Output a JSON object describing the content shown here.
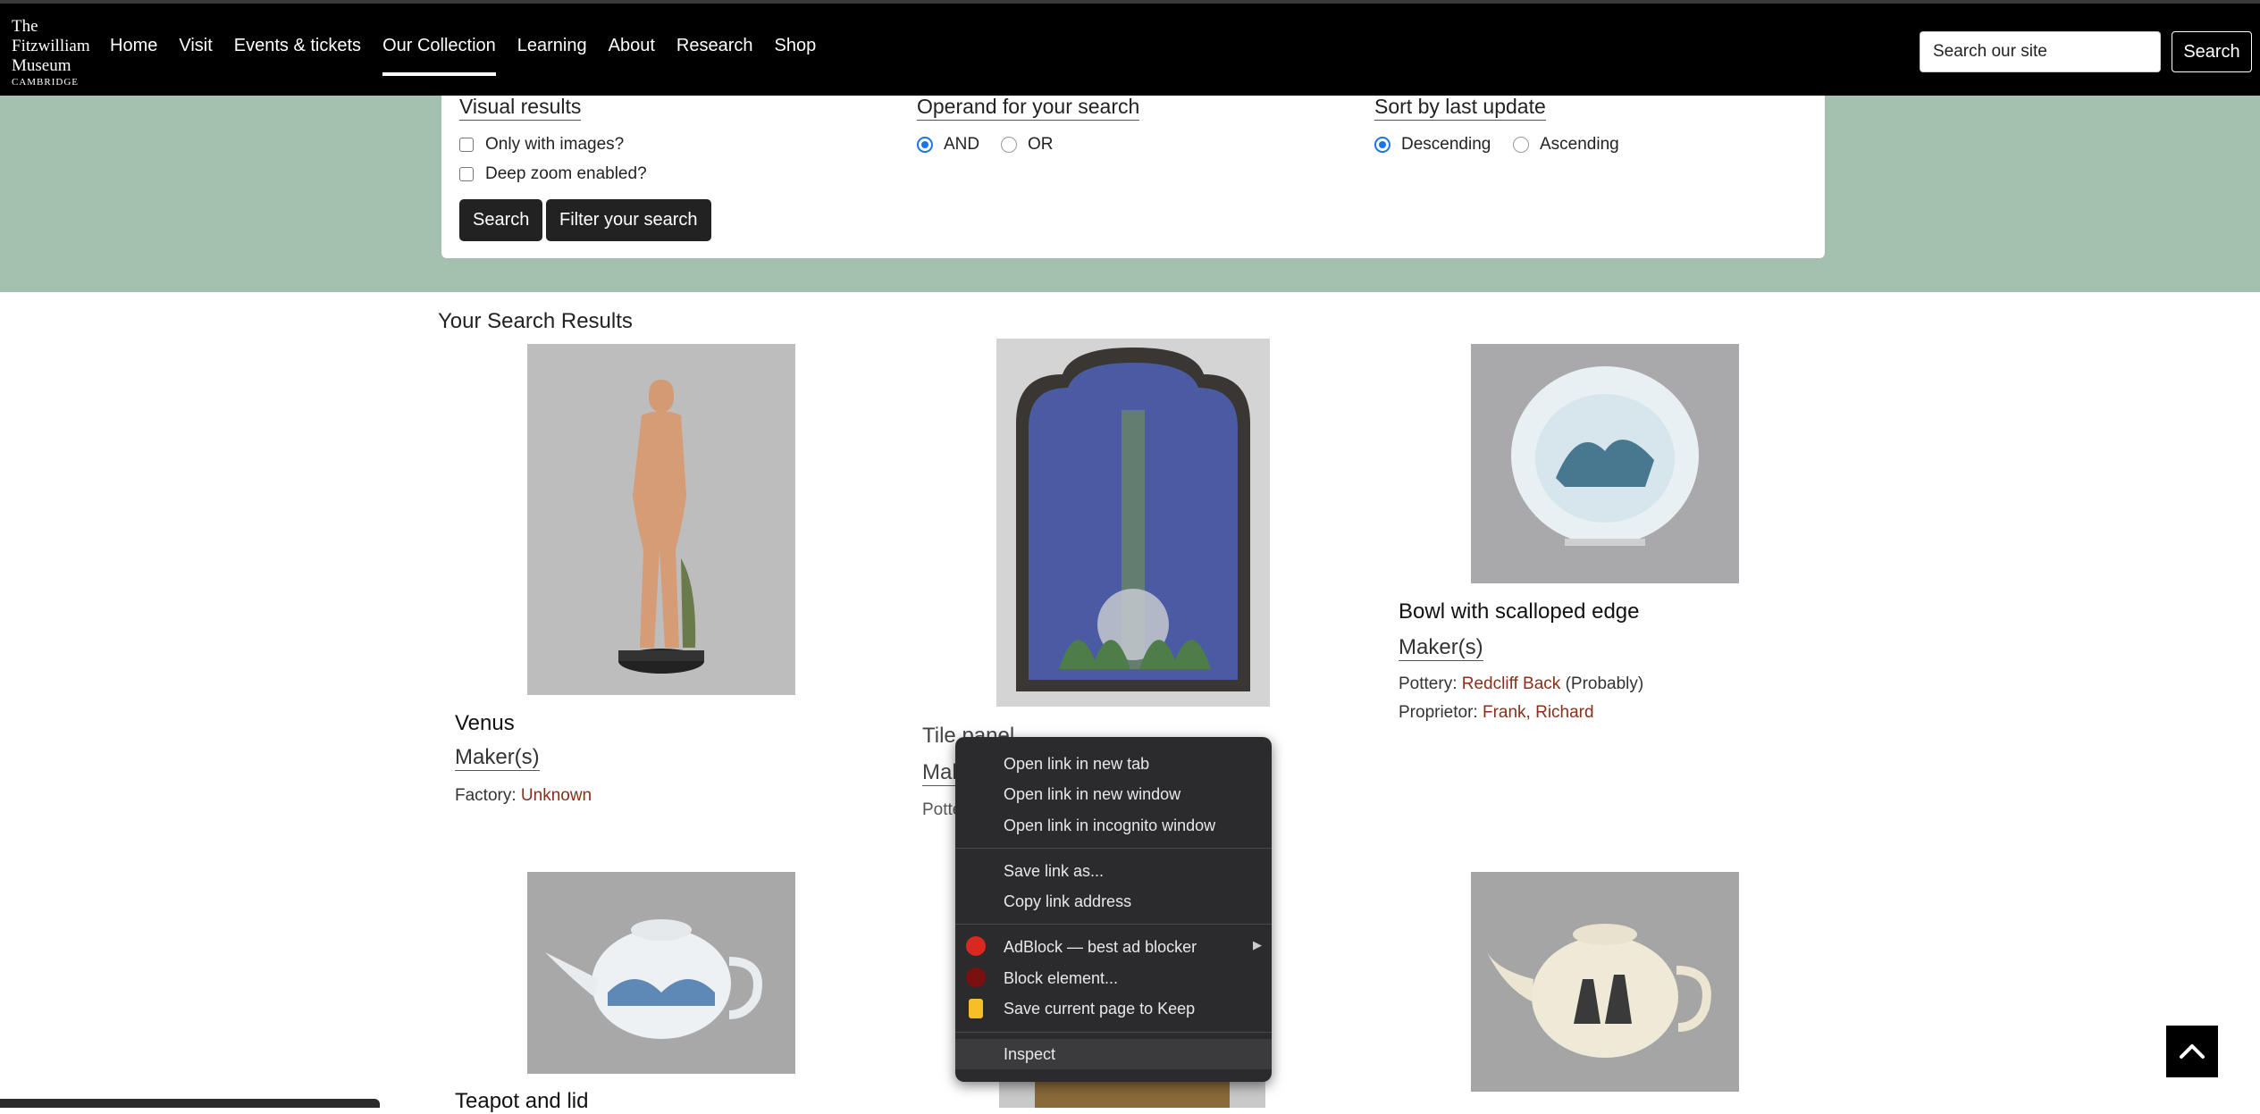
{
  "header": {
    "logo": {
      "line1": "The",
      "line2": "Fitzwilliam",
      "line3": "Museum",
      "line4": "CAMBRIDGE"
    },
    "nav": [
      "Home",
      "Visit",
      "Events & tickets",
      "Our Collection",
      "Learning",
      "About",
      "Research",
      "Shop"
    ],
    "active_nav": "Our Collection",
    "search_placeholder": "Search our site",
    "search_button": "Search"
  },
  "filters": {
    "visual": {
      "title": "Visual results",
      "only_images": "Only with images?",
      "deep_zoom": "Deep zoom enabled?"
    },
    "operand": {
      "title": "Operand for your search",
      "and": "AND",
      "or": "OR",
      "selected": "AND"
    },
    "sort": {
      "title": "Sort by last update",
      "descending": "Descending",
      "ascending": "Ascending",
      "selected": "Descending"
    },
    "search_button": "Search",
    "filter_button": "Filter your search"
  },
  "results": {
    "title": "Your Search Results",
    "items": [
      {
        "title": "Venus",
        "maker_label": "Maker(s)",
        "meta": [
          {
            "label": "Factory:",
            "value": "Unknown",
            "suffix": ""
          }
        ]
      },
      {
        "title": "Tile panel",
        "maker_label": "Maker(s)",
        "meta": [
          {
            "label": "Pottery:",
            "value": "",
            "suffix": ""
          }
        ]
      },
      {
        "title": "Bowl with scalloped edge",
        "maker_label": "Maker(s)",
        "meta": [
          {
            "label": "Pottery:",
            "value": "Redcliff Back",
            "suffix": "(Probably)"
          },
          {
            "label": "Proprietor:",
            "value": "Frank, Richard",
            "suffix": ""
          }
        ]
      },
      {
        "title": "Teapot and lid"
      }
    ]
  },
  "context_menu": {
    "items": [
      "Open link in new tab",
      "Open link in new window",
      "Open link in incognito window",
      "Save link as...",
      "Copy link address",
      "AdBlock — best ad blocker",
      "Block element...",
      "Save current page to Keep",
      "Inspect"
    ],
    "icons": [
      "adblock-icon",
      "ublock-icon",
      "keep-icon"
    ]
  },
  "colors": {
    "band": "#a4c0ae",
    "link": "#8b2e1b",
    "radio": "#1a73e8"
  }
}
